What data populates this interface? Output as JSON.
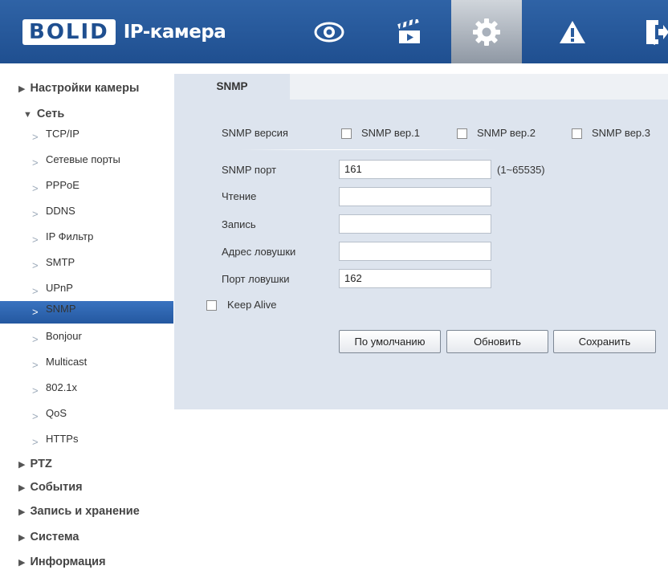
{
  "header": {
    "logo_brand": "BOLID",
    "logo_display": "ΒΟLΙD",
    "app_title": "IP-камера",
    "nav": [
      {
        "icon": "eye-icon"
      },
      {
        "icon": "clapperboard-icon"
      },
      {
        "icon": "gear-icon",
        "active": true
      },
      {
        "icon": "warning-icon"
      },
      {
        "icon": "exit-icon"
      }
    ]
  },
  "sidebar": {
    "camera_settings": "Настройки камеры",
    "network": "Сеть",
    "network_items": [
      "TCP/IP",
      "Сетевые порты",
      "PPPoE",
      "DDNS",
      "IP Фильтр",
      "SMTP",
      "UPnP",
      "SNMP",
      "Bonjour",
      "Multicast",
      "802.1x",
      "QoS",
      "HTTPs"
    ],
    "active_item": "SNMP",
    "ptz": "PTZ",
    "events": "События",
    "record_storage": "Запись и хранение",
    "system": "Система",
    "info": "Информация"
  },
  "tab": {
    "label": "SNMP"
  },
  "form": {
    "version_label": "SNMP версия",
    "v1_label": "SNMP вер.1",
    "v2_label": "SNMP вер.2",
    "v3_label": "SNMP вер.3",
    "v1_checked": false,
    "v2_checked": false,
    "v3_checked": false,
    "port_label": "SNMP порт",
    "port_value": "161",
    "port_range": "(1~65535)",
    "read_label": "Чтение",
    "read_value": "",
    "write_label": "Запись",
    "write_value": "",
    "trap_address_label": "Адрес ловушки",
    "trap_address_value": "",
    "trap_port_label": "Порт ловушки",
    "trap_port_value": "162",
    "keepalive_label": "Keep Alive",
    "keepalive_checked": false
  },
  "buttons": {
    "default": "По умолчанию",
    "refresh": "Обновить",
    "save": "Сохранить"
  },
  "colors": {
    "header_bg": "#2a5c9e",
    "panel_bg": "#dde4ee",
    "active_item_bg": "#2f66b0"
  }
}
